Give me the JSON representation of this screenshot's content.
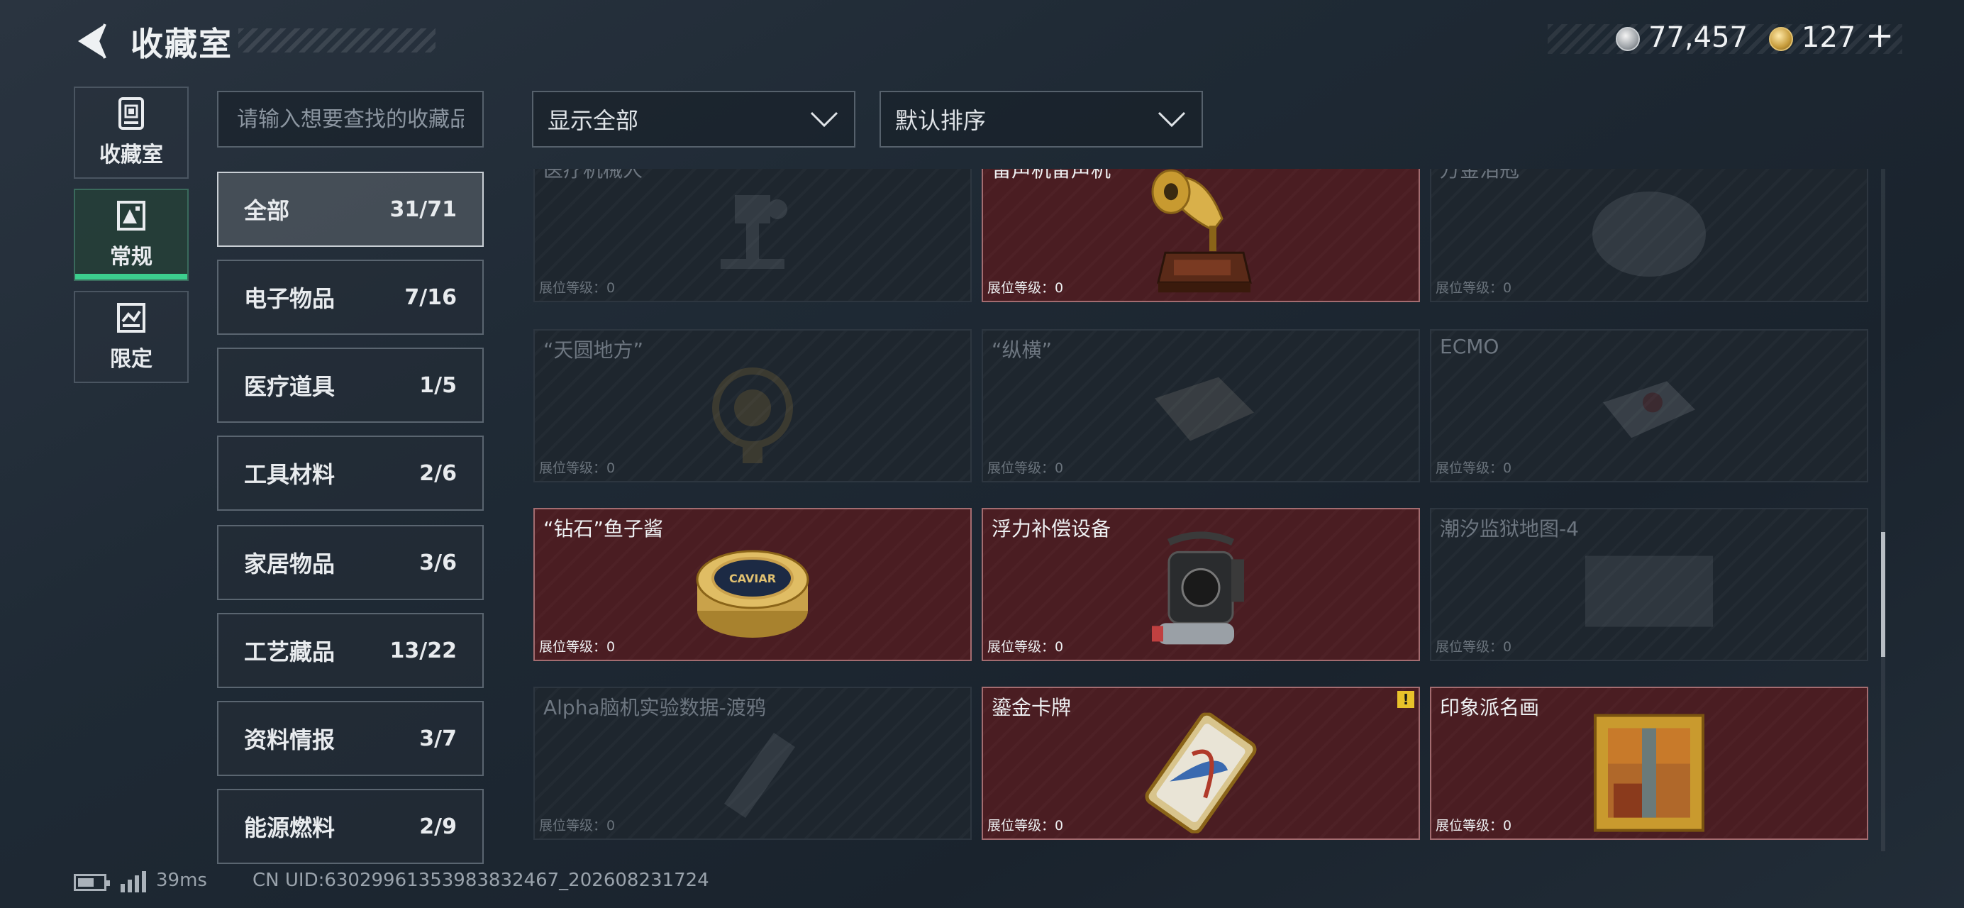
{
  "header": {
    "title": "收藏室"
  },
  "currency": {
    "silver": "77,457",
    "gold": "127",
    "plus": "+"
  },
  "rail": [
    {
      "label": "收藏室",
      "icon": "collection-room-icon"
    },
    {
      "label": "常规",
      "icon": "normal-gallery-icon",
      "active": true
    },
    {
      "label": "限定",
      "icon": "limited-icon"
    }
  ],
  "search": {
    "placeholder": "请输入想要查找的收藏品"
  },
  "filters": {
    "show": "显示全部",
    "sort": "默认排序"
  },
  "categories": [
    {
      "name": "全部",
      "count": "31/71",
      "active": true
    },
    {
      "name": "电子物品",
      "count": "7/16"
    },
    {
      "name": "医疗道具",
      "count": "1/5"
    },
    {
      "name": "工具材料",
      "count": "2/6"
    },
    {
      "name": "家居物品",
      "count": "3/6"
    },
    {
      "name": "工艺藏品",
      "count": "13/22"
    },
    {
      "name": "资料情报",
      "count": "3/7"
    },
    {
      "name": "能源燃料",
      "count": "2/9"
    }
  ],
  "level_label": "展位等级：0",
  "items": [
    {
      "name": "医疗机械人",
      "owned": false,
      "icon": "medical-robot-icon"
    },
    {
      "name": "留声机留声机",
      "owned": true,
      "icon": "gramophone-icon"
    },
    {
      "name": "万金泪冠",
      "owned": false,
      "icon": "crown-icon"
    },
    {
      "name": "“天圆地方”",
      "owned": false,
      "icon": "armillary-icon"
    },
    {
      "name": "“纵横”",
      "owned": false,
      "icon": "chessboard-icon"
    },
    {
      "name": "ECMO",
      "owned": false,
      "icon": "ecmo-icon"
    },
    {
      "name": "“钻石”鱼子酱",
      "owned": true,
      "icon": "caviar-tin-icon"
    },
    {
      "name": "浮力补偿设备",
      "owned": true,
      "icon": "buoyancy-device-icon"
    },
    {
      "name": "潮汐监狱地图-4",
      "owned": false,
      "icon": "map-icon"
    },
    {
      "name": "Alpha脑机实验数据-渡鸦",
      "owned": false,
      "icon": "data-drive-icon"
    },
    {
      "name": "鎏金卡牌",
      "owned": true,
      "warning": true,
      "icon": "gilded-card-icon"
    },
    {
      "name": "印象派名画",
      "owned": true,
      "icon": "framed-painting-icon"
    }
  ],
  "caviar_text": "CAVIAR",
  "warning_mark": "!",
  "footer": {
    "ping": "39ms",
    "uid": "CN UID:630299613539838324​67_202608231724"
  }
}
